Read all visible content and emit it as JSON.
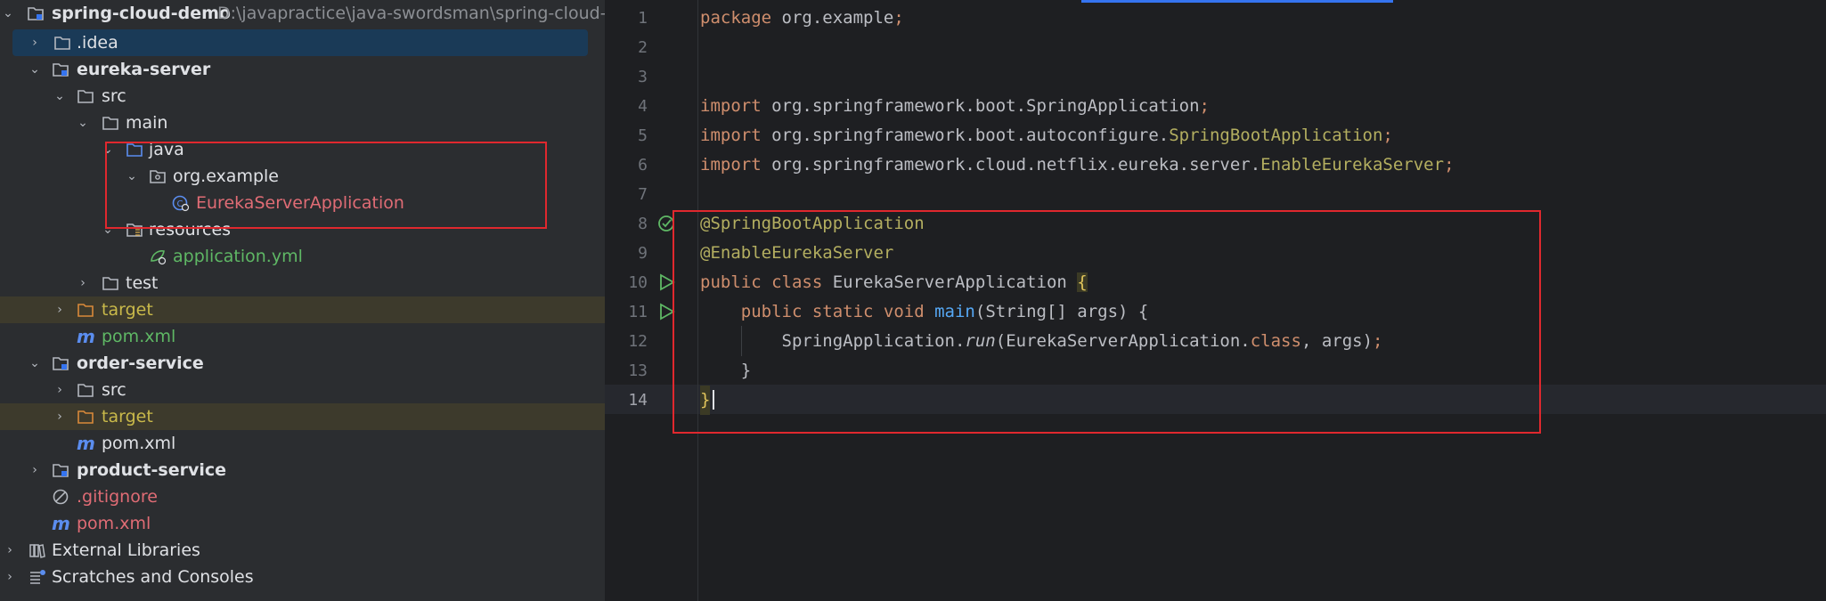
{
  "project_tree": {
    "root": {
      "name": "spring-cloud-demo",
      "path": "D:\\javapractice\\java-swordsman\\spring-cloud-demo"
    },
    "idea": ".idea",
    "eureka_server": "eureka-server",
    "src": "src",
    "main": "main",
    "java": "java",
    "org_example": "org.example",
    "app_class": "EurekaServerApplication",
    "resources": "resources",
    "application_yml": "application.yml",
    "test": "test",
    "target1": "target",
    "pom1": "pom.xml",
    "order_service": "order-service",
    "src2": "src",
    "target2": "target",
    "pom2": "pom.xml",
    "product_service": "product-service",
    "gitignore": ".gitignore",
    "pom_root": "pom.xml",
    "external_libraries": "External Libraries",
    "scratches": "Scratches and Consoles"
  },
  "editor": {
    "line_numbers": [
      "1",
      "2",
      "3",
      "4",
      "5",
      "6",
      "7",
      "8",
      "9",
      "10",
      "11",
      "12",
      "13",
      "14"
    ],
    "l1a": "package",
    "l1b": " org.example",
    "l1c": ";",
    "imp": "import",
    "l4b": " org.springframework.boot.SpringApplication",
    "l5b": " org.springframework.boot.autoconfigure.",
    "l5c": "SpringBootApplication",
    "l6b": " org.springframework.cloud.netflix.eureka.server.",
    "l6c": "EnableEurekaServer",
    "semi": ";",
    "l8": "@SpringBootApplication",
    "l9": "@EnableEurekaServer",
    "l10a": "public class",
    "l10b": " EurekaServerApplication ",
    "l10c": "{",
    "l11a": "    public static void",
    "l11b": " main",
    "l11c": "(String[] args) {",
    "l12a": "        SpringApplication.",
    "l12b": "run",
    "l12c": "(EurekaServerApplication.",
    "l12d": "class",
    "l12e": ", args)",
    "l13": "    }",
    "l14": "}"
  },
  "colors": {
    "highlight_box": "#e0282e",
    "selection": "#1a3a57"
  }
}
